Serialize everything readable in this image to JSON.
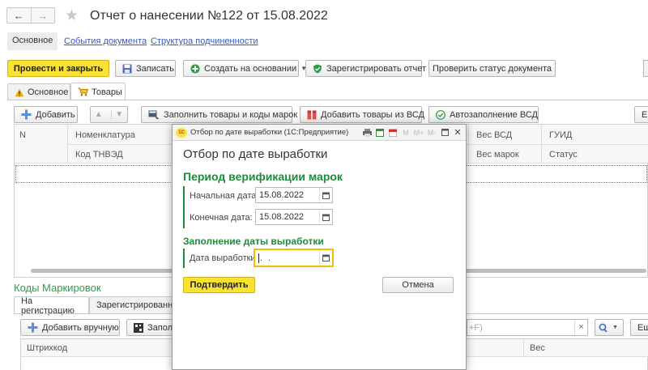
{
  "window": {
    "title": "Отчет о нанесении №122 от 15.08.2022",
    "back_label": "←",
    "forward_label": "→",
    "star": "★"
  },
  "section_links": [
    {
      "label": "Основное",
      "active": true
    },
    {
      "label": "События документа",
      "active": false
    },
    {
      "label": "Структура подчиненности",
      "active": false
    }
  ],
  "toolbar": {
    "post_close": "Провести и закрыть",
    "save": "Записать",
    "create_based": "Создать на основании",
    "register_report": "Зарегистрировать отчет",
    "check_status": "Проверить статус документа"
  },
  "tabs": [
    {
      "label": "Основное",
      "icon": "warning-icon"
    },
    {
      "label": "Товары",
      "icon": "cart-icon"
    }
  ],
  "goods_toolbar": {
    "add": "Добавить",
    "fill_goods": "Заполнить товары и коды марок",
    "add_from_vsd": "Добавить товары из ВСД",
    "autofill_vsd": "Автозаполнение ВСД",
    "right_cut": "Е"
  },
  "goods_table": {
    "row1": {
      "n": "N",
      "nomenclature": "Номенклатура",
      "weight_vsd": "Вес ВСД",
      "guid": "ГУИД"
    },
    "row2": {
      "tnved": "Код ТНВЭД",
      "weight_marks": "Вес марок",
      "status": "Статус"
    }
  },
  "codes_section": {
    "title": "Коды Маркировок",
    "tabs": [
      "На регистрацию",
      "Зарегистрированны"
    ],
    "add_manual": "Добавить вручную",
    "fill_cut": "Заполн",
    "search_hint": "+F)",
    "clear": "×",
    "right_cut": "Ещ",
    "col_barcode": "Штрихкод",
    "col_weight": "Вес"
  },
  "modal": {
    "window_title": "Отбор по дате выработки  (1С:Предприятие)",
    "toolbar_labels": [
      "M",
      "M+",
      "M-"
    ],
    "heading": "Отбор по дате выработки",
    "period_title": "Период верификации марок",
    "start_label": "Начальная дата:",
    "start_value": "15.08.2022",
    "end_label": "Конечная дата:",
    "end_value": "15.08.2022",
    "fill_title": "Заполнение даты выработки",
    "prod_label": "Дата выработки:",
    "prod_value": " .  .",
    "confirm": "Подтвердить",
    "cancel": "Отмена"
  },
  "colors": {
    "accent_yellow": "#f9e232",
    "green_heading": "#1e8a3c",
    "link_blue": "#3b5bb5",
    "codes_title_green": "#2f9a4a"
  }
}
